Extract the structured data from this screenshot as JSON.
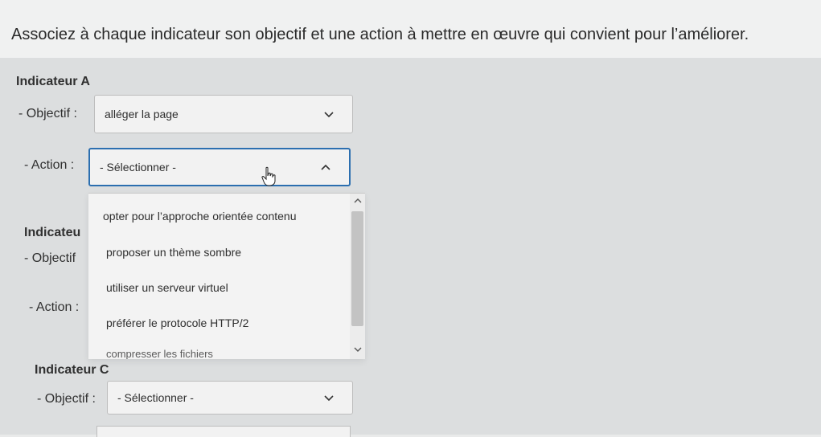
{
  "instruction": "Associez à chaque indicateur son objectif et une action à mettre en œuvre qui convient pour l’améliorer.",
  "indicators": [
    {
      "title": "Indicateur A",
      "objective_label": "- Objectif :",
      "objective_value": "alléger la page",
      "action_label": "- Action :",
      "action_value": "- Sélectionner -"
    },
    {
      "title": "Indicateu",
      "objective_label": "- Objectif",
      "action_label": "- Action :"
    },
    {
      "title": "Indicateur C",
      "objective_label": "- Objectif :",
      "objective_value": "- Sélectionner -"
    }
  ],
  "dropdown": {
    "options": [
      "opter pour l’approche orientée contenu",
      "proposer un thème sombre",
      "utiliser un serveur virtuel",
      "préférer le protocole HTTP/2",
      "compresser les fichiers"
    ]
  },
  "icons": {
    "select_closed": "chevron-down-icon",
    "select_open": "chevron-up-icon",
    "cursor": "hand-pointer-icon"
  },
  "colors": {
    "focus_border": "#2c6fb0",
    "panel_bg": "#dcdedf",
    "header_bg": "#f0f1f1"
  }
}
